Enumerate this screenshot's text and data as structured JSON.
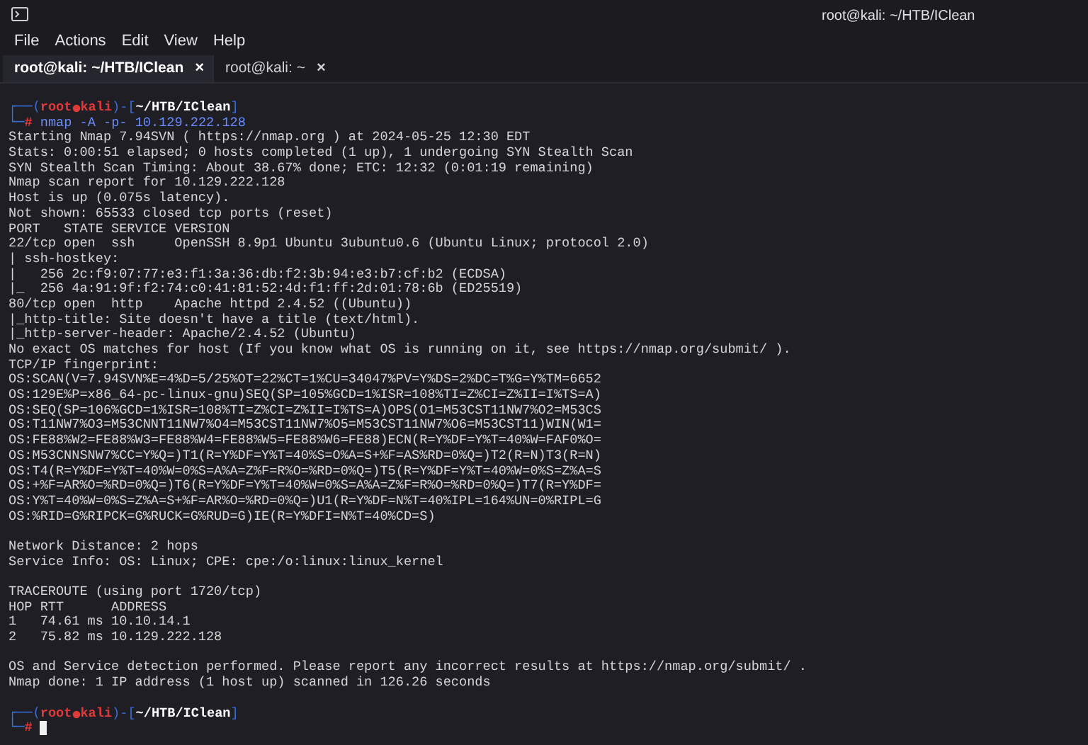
{
  "window": {
    "title": "root@kali: ~/HTB/IClean"
  },
  "menu": [
    "File",
    "Actions",
    "Edit",
    "View",
    "Help"
  ],
  "tabs": [
    {
      "label": "root@kali: ~/HTB/IClean",
      "close": "×",
      "selected": true
    },
    {
      "label": "root@kali: ~",
      "close": "×",
      "selected": false
    }
  ],
  "terminal": {
    "lines": [
      {
        "kind": "prompt",
        "open": "┌──(",
        "user": "root",
        "host": "kali",
        "mid": ")-[",
        "path": "~/HTB/IClean",
        "close": "]"
      },
      {
        "kind": "command",
        "lead": "└─",
        "sign": "#",
        "text": "nmap -A -p- 10.129.222.128"
      },
      {
        "kind": "output",
        "text": "Starting Nmap 7.94SVN ( https://nmap.org ) at 2024-05-25 12:30 EDT"
      },
      {
        "kind": "output",
        "text": "Stats: 0:00:51 elapsed; 0 hosts completed (1 up), 1 undergoing SYN Stealth Scan"
      },
      {
        "kind": "output",
        "text": "SYN Stealth Scan Timing: About 38.67% done; ETC: 12:32 (0:01:19 remaining)"
      },
      {
        "kind": "output",
        "text": "Nmap scan report for 10.129.222.128"
      },
      {
        "kind": "output",
        "text": "Host is up (0.075s latency)."
      },
      {
        "kind": "output",
        "text": "Not shown: 65533 closed tcp ports (reset)"
      },
      {
        "kind": "output",
        "text": "PORT   STATE SERVICE VERSION"
      },
      {
        "kind": "output",
        "text": "22/tcp open  ssh     OpenSSH 8.9p1 Ubuntu 3ubuntu0.6 (Ubuntu Linux; protocol 2.0)"
      },
      {
        "kind": "output",
        "text": "| ssh-hostkey:"
      },
      {
        "kind": "output",
        "text": "|   256 2c:f9:07:77:e3:f1:3a:36:db:f2:3b:94:e3:b7:cf:b2 (ECDSA)"
      },
      {
        "kind": "output",
        "text": "|_  256 4a:91:9f:f2:74:c0:41:81:52:4d:f1:ff:2d:01:78:6b (ED25519)"
      },
      {
        "kind": "output",
        "text": "80/tcp open  http    Apache httpd 2.4.52 ((Ubuntu))"
      },
      {
        "kind": "output",
        "text": "|_http-title: Site doesn't have a title (text/html)."
      },
      {
        "kind": "output",
        "text": "|_http-server-header: Apache/2.4.52 (Ubuntu)"
      },
      {
        "kind": "output",
        "text": "No exact OS matches for host (If you know what OS is running on it, see https://nmap.org/submit/ )."
      },
      {
        "kind": "output",
        "text": "TCP/IP fingerprint:"
      },
      {
        "kind": "output",
        "text": "OS:SCAN(V=7.94SVN%E=4%D=5/25%OT=22%CT=1%CU=34047%PV=Y%DS=2%DC=T%G=Y%TM=6652"
      },
      {
        "kind": "output",
        "text": "OS:129E%P=x86_64-pc-linux-gnu)SEQ(SP=105%GCD=1%ISR=108%TI=Z%CI=Z%II=I%TS=A)"
      },
      {
        "kind": "output",
        "text": "OS:SEQ(SP=106%GCD=1%ISR=108%TI=Z%CI=Z%II=I%TS=A)OPS(O1=M53CST11NW7%O2=M53CS"
      },
      {
        "kind": "output",
        "text": "OS:T11NW7%O3=M53CNNT11NW7%O4=M53CST11NW7%O5=M53CST11NW7%O6=M53CST11)WIN(W1="
      },
      {
        "kind": "output",
        "text": "OS:FE88%W2=FE88%W3=FE88%W4=FE88%W5=FE88%W6=FE88)ECN(R=Y%DF=Y%T=40%W=FAF0%O="
      },
      {
        "kind": "output",
        "text": "OS:M53CNNSNW7%CC=Y%Q=)T1(R=Y%DF=Y%T=40%S=O%A=S+%F=AS%RD=0%Q=)T2(R=N)T3(R=N)"
      },
      {
        "kind": "output",
        "text": "OS:T4(R=Y%DF=Y%T=40%W=0%S=A%A=Z%F=R%O=%RD=0%Q=)T5(R=Y%DF=Y%T=40%W=0%S=Z%A=S"
      },
      {
        "kind": "output",
        "text": "OS:+%F=AR%O=%RD=0%Q=)T6(R=Y%DF=Y%T=40%W=0%S=A%A=Z%F=R%O=%RD=0%Q=)T7(R=Y%DF="
      },
      {
        "kind": "output",
        "text": "OS:Y%T=40%W=0%S=Z%A=S+%F=AR%O=%RD=0%Q=)U1(R=Y%DF=N%T=40%IPL=164%UN=0%RIPL=G"
      },
      {
        "kind": "output",
        "text": "OS:%RID=G%RIPCK=G%RUCK=G%RUD=G)IE(R=Y%DFI=N%T=40%CD=S)"
      },
      {
        "kind": "blank"
      },
      {
        "kind": "output",
        "text": "Network Distance: 2 hops"
      },
      {
        "kind": "output",
        "text": "Service Info: OS: Linux; CPE: cpe:/o:linux:linux_kernel"
      },
      {
        "kind": "blank"
      },
      {
        "kind": "output",
        "text": "TRACEROUTE (using port 1720/tcp)"
      },
      {
        "kind": "output",
        "text": "HOP RTT      ADDRESS"
      },
      {
        "kind": "output",
        "text": "1   74.61 ms 10.10.14.1"
      },
      {
        "kind": "output",
        "text": "2   75.82 ms 10.129.222.128"
      },
      {
        "kind": "blank"
      },
      {
        "kind": "output",
        "text": "OS and Service detection performed. Please report any incorrect results at https://nmap.org/submit/ ."
      },
      {
        "kind": "output",
        "text": "Nmap done: 1 IP address (1 host up) scanned in 126.26 seconds"
      },
      {
        "kind": "blank"
      },
      {
        "kind": "prompt",
        "open": "┌──(",
        "user": "root",
        "host": "kali",
        "mid": ")-[",
        "path": "~/HTB/IClean",
        "close": "]"
      },
      {
        "kind": "command",
        "lead": "└─",
        "sign": "#"
      }
    ]
  }
}
